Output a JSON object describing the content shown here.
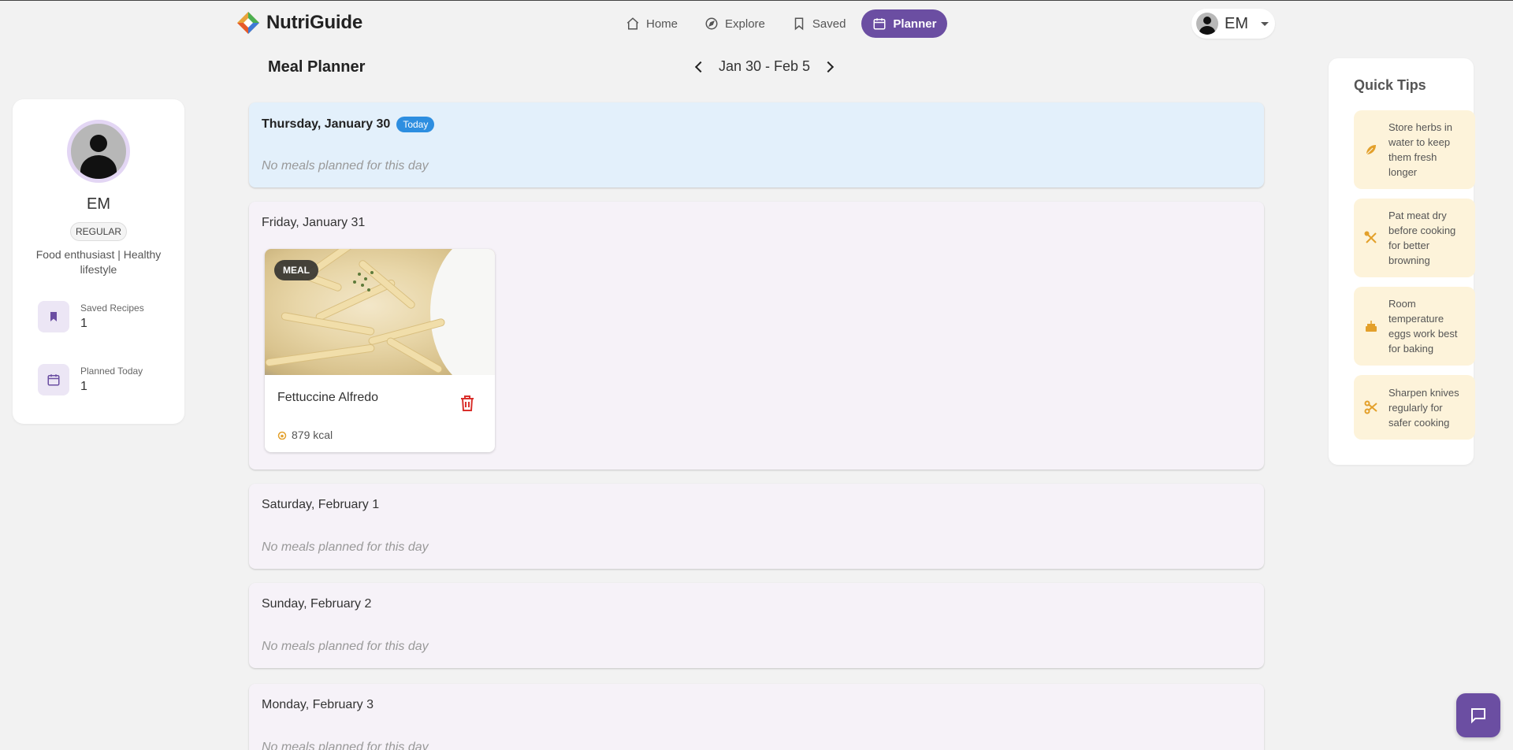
{
  "app": {
    "name": "NutriGuide"
  },
  "nav": {
    "items": [
      {
        "label": "Home",
        "icon": "home-icon",
        "active": false
      },
      {
        "label": "Explore",
        "icon": "compass-icon",
        "active": false
      },
      {
        "label": "Saved",
        "icon": "bookmark-icon",
        "active": false
      },
      {
        "label": "Planner",
        "icon": "calendar-icon",
        "active": true
      }
    ]
  },
  "user": {
    "initials": "EM"
  },
  "profile": {
    "name": "EM",
    "badge": "REGULAR",
    "bio": "Food enthusiast | Healthy lifestyle",
    "stats": [
      {
        "label": "Saved Recipes",
        "value": "1",
        "icon": "bookmark-icon"
      },
      {
        "label": "Planned Today",
        "value": "1",
        "icon": "calendar-icon"
      }
    ]
  },
  "planner": {
    "title": "Meal Planner",
    "range": "Jan 30 - Feb 5",
    "today_label": "Today",
    "empty_text": "No meals planned for this day",
    "days": [
      {
        "title": "Thursday, January 30",
        "today": true,
        "empty": "No meals planned for this day"
      },
      {
        "title": "Friday, January 31",
        "today": false,
        "meal": {
          "tag": "MEAL",
          "name": "Fettuccine Alfredo",
          "kcal": "879 kcal"
        }
      },
      {
        "title": "Saturday, February 1",
        "today": false,
        "empty": "No meals planned for this day"
      },
      {
        "title": "Sunday, February 2",
        "today": false,
        "empty": "No meals planned for this day"
      },
      {
        "title": "Monday, February 3",
        "today": false,
        "empty": "No meals planned for this day"
      }
    ]
  },
  "tips": {
    "title": "Quick Tips",
    "items": [
      {
        "text": "Store herbs in water to keep them fresh longer",
        "icon": "leaf-icon"
      },
      {
        "text": "Pat meat dry before cooking for better browning",
        "icon": "utensils-icon"
      },
      {
        "text": "Room temperature eggs work best for baking",
        "icon": "cake-icon"
      },
      {
        "text": "Sharpen knives regularly for safer cooking",
        "icon": "scissors-icon"
      }
    ]
  },
  "colors": {
    "accent": "#6b4ea2",
    "today_bg": "#e3f0fb",
    "today_chip": "#2d8ee0",
    "tip_bg": "#fdf3da",
    "danger": "#d9302c"
  }
}
